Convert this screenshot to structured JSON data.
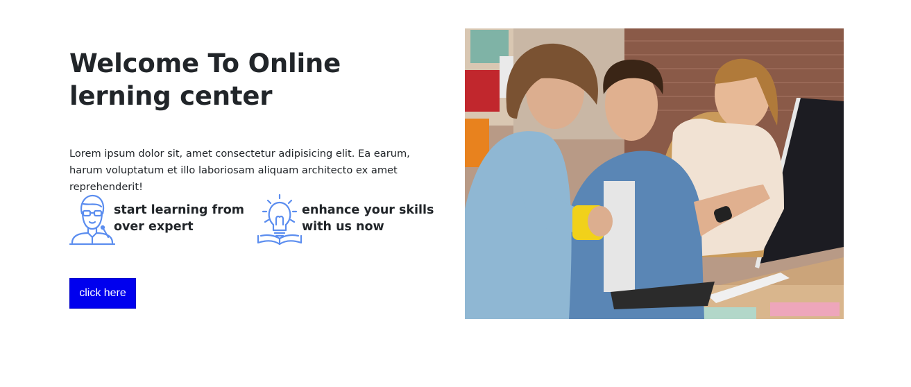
{
  "hero": {
    "title_line1": "Welcome To Online",
    "title_line2": "lerning center",
    "description": "Lorem ipsum dolor sit, amet consectetur adipisicing elit. Ea earum, harum voluptatum et illo laboriosam aliquam architecto ex amet reprehenderit!",
    "features": [
      {
        "icon": "teacher-icon",
        "line1": "start learning from",
        "line2": "over expert"
      },
      {
        "icon": "lightbulb-book-icon",
        "line1": "enhance your skills",
        "line2": "with us now"
      }
    ],
    "cta_label": "click here",
    "colors": {
      "icon": "#5b8def",
      "cta": "#0000ee",
      "text": "#212529"
    }
  }
}
